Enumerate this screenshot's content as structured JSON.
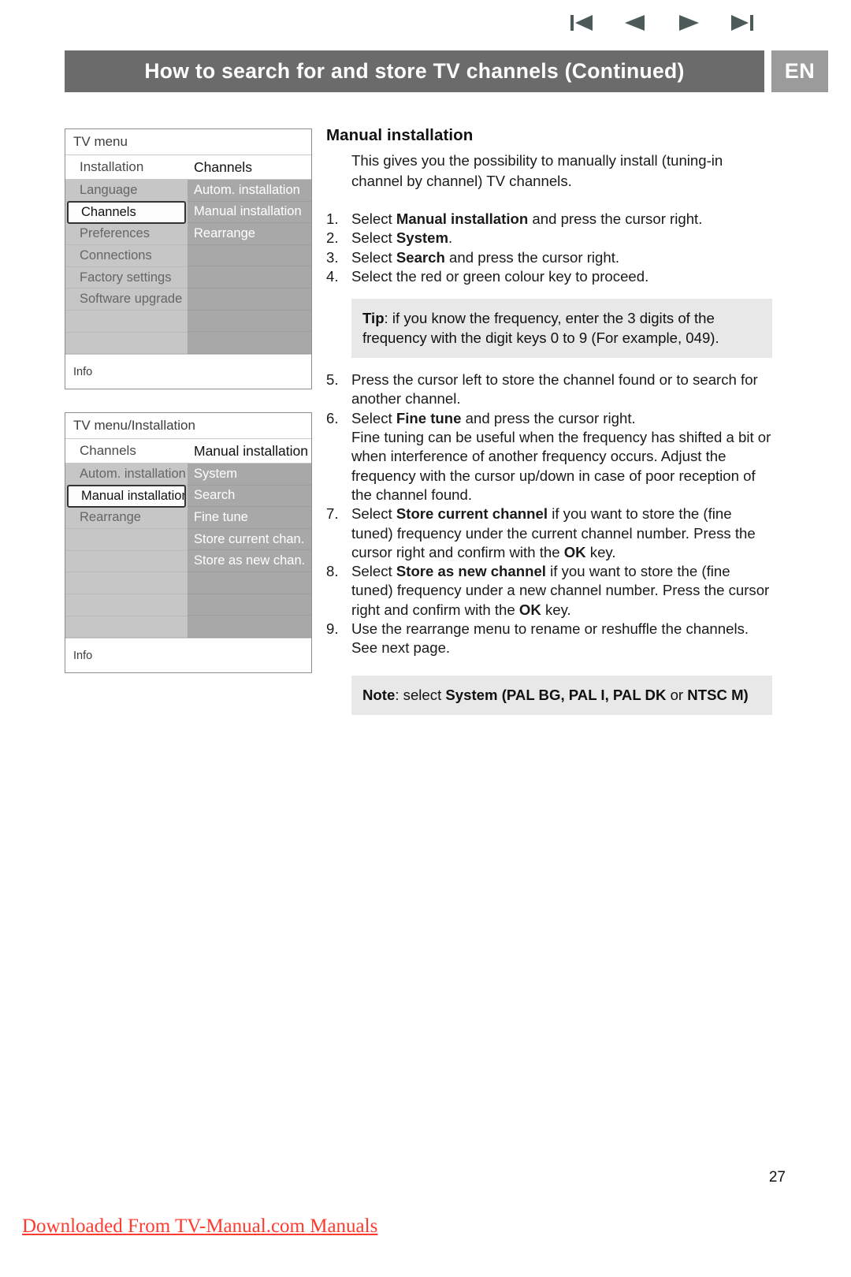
{
  "nav": {
    "buttons": [
      {
        "name": "first-page",
        "icon": "skip-back-icon"
      },
      {
        "name": "previous-page",
        "icon": "play-back-icon"
      },
      {
        "name": "next-page",
        "icon": "play-forward-icon"
      },
      {
        "name": "last-page",
        "icon": "skip-forward-icon"
      }
    ]
  },
  "header": {
    "title": "How to search for and store TV channels  (Continued)",
    "language_badge": "EN",
    "bar_color": "#6b6b6b",
    "badge_color": "#9b9b9b"
  },
  "menu_one": {
    "title": "TV menu",
    "sub_left": "Installation",
    "sub_right": "Channels",
    "left_items": [
      {
        "label": "Language",
        "selected": false
      },
      {
        "label": "Channels",
        "selected": true
      },
      {
        "label": "Preferences",
        "selected": false
      },
      {
        "label": "Connections",
        "selected": false
      },
      {
        "label": "Factory settings",
        "selected": false
      },
      {
        "label": "Software upgrade",
        "selected": false
      },
      {
        "label": "",
        "selected": false
      },
      {
        "label": "",
        "selected": false
      }
    ],
    "right_items": [
      "Autom. installation",
      "Manual installation",
      "Rearrange",
      "",
      "",
      "",
      "",
      ""
    ],
    "footer": "Info"
  },
  "menu_two": {
    "title": "TV menu/Installation",
    "sub_left": "Channels",
    "sub_right": "Manual installation",
    "left_items": [
      {
        "label": "Autom. installation",
        "selected": false
      },
      {
        "label": "Manual installation",
        "selected": true
      },
      {
        "label": "Rearrange",
        "selected": false
      },
      {
        "label": "",
        "selected": false
      },
      {
        "label": "",
        "selected": false
      },
      {
        "label": "",
        "selected": false
      },
      {
        "label": "",
        "selected": false
      },
      {
        "label": "",
        "selected": false
      }
    ],
    "right_items": [
      "System",
      "Search",
      "Fine tune",
      "Store current chan.",
      "Store as new chan.",
      "",
      "",
      ""
    ],
    "footer": "Info"
  },
  "content": {
    "heading": "Manual installation",
    "intro": "This gives you the possibility to manually install (tuning-in channel by channel) TV channels.",
    "steps_a": [
      {
        "num": "1.",
        "html": "Select <b>Manual installation</b> and press the cursor right."
      },
      {
        "num": "2.",
        "html": "Select <b>System</b>."
      },
      {
        "num": "3.",
        "html": "Select <b>Search</b> and press the cursor right."
      },
      {
        "num": "4.",
        "html": "Select the red or green colour key to proceed."
      }
    ],
    "tip": "<b>Tip</b>: if you know the frequency, enter the 3 digits of the frequency with the digit keys 0 to 9 (For example, 049).",
    "steps_b": [
      {
        "num": "5.",
        "html": "Press the cursor left to store the channel found or to search for another channel."
      },
      {
        "num": "6.",
        "html": "Select <b>Fine tune</b> and press the cursor right.<br>Fine tuning can be useful when the frequency has shifted a bit or when interference of another frequency occurs. Adjust the frequency with the cursor up/down in case of poor reception of the channel found."
      },
      {
        "num": "7.",
        "html": "Select <b>Store current channel</b> if you want to store the (fine tuned) frequency under the current channel number. Press the cursor right and confirm with the <b>OK</b> key."
      },
      {
        "num": "8.",
        "html": "Select <b>Store as new channel</b> if you want to store the (fine tuned) frequency under a new channel number. Press the cursor right and confirm with the <b>OK</b> key."
      },
      {
        "num": "9.",
        "html": "Use the rearrange menu to rename or reshuffle the channels. See next page."
      }
    ],
    "note": "<b>Note</b>: select <b>System (PAL BG, PAL I, PAL DK</b> or <b>NTSC M)</b>"
  },
  "footer": {
    "page_number": "27",
    "download_stamp": "Downloaded From TV-Manual.com Manuals",
    "stamp_color": "#ff3b30"
  }
}
